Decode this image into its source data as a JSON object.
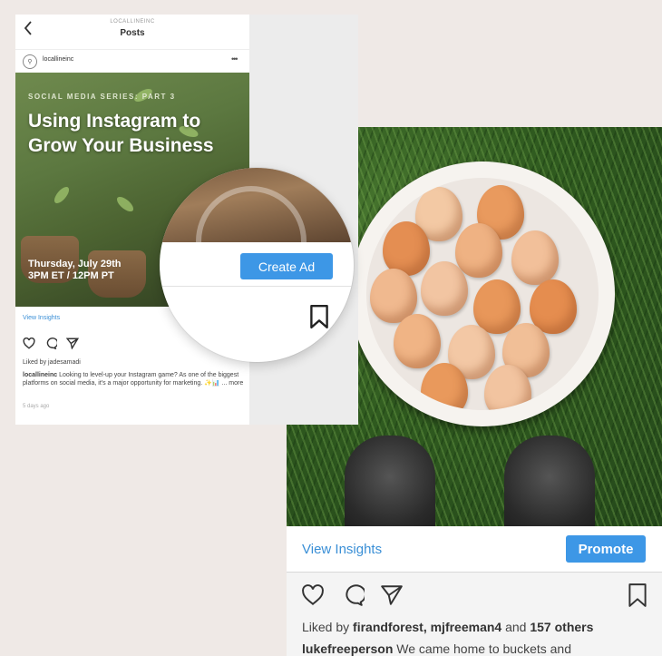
{
  "left_screen": {
    "account_small": "LOCALLINEINC",
    "title": "Posts",
    "username": "locallineinc",
    "avatar_glyph": "⚲",
    "image": {
      "series_label": "SOCIAL MEDIA SERIES: PART 3",
      "headline": "Using Instagram to Grow Your Business",
      "date_line": "Thursday, July 29th",
      "time_line": "3PM ET / 12PM PT"
    },
    "view_insights": "View Insights",
    "create_ad": "Create Ad",
    "liked_by": "Liked by jadesamadi",
    "caption_user": "locallineinc",
    "caption_text": "Looking to level-up your Instagram game? As one of the biggest platforms on social media, it's a major opportunity for marketing. ✨📊 ... more",
    "time_ago": "5 days ago"
  },
  "right_screen": {
    "view_insights": "View Insights",
    "promote": "Promote",
    "likes_prefix": "Liked by ",
    "likes_users": "firandforest, mjfreeman4",
    "likes_middle": " and ",
    "likes_others": "157 others",
    "caption_user": "lukefreeperson",
    "caption_text": " We came home to buckets and"
  },
  "colors": {
    "accent_blue": "#3d97e6",
    "link_blue": "#3a8fd6",
    "background": "#efe9e6"
  },
  "icons": [
    "back-icon",
    "heart-icon",
    "comment-icon",
    "share-icon",
    "bookmark-icon",
    "more-icon"
  ]
}
